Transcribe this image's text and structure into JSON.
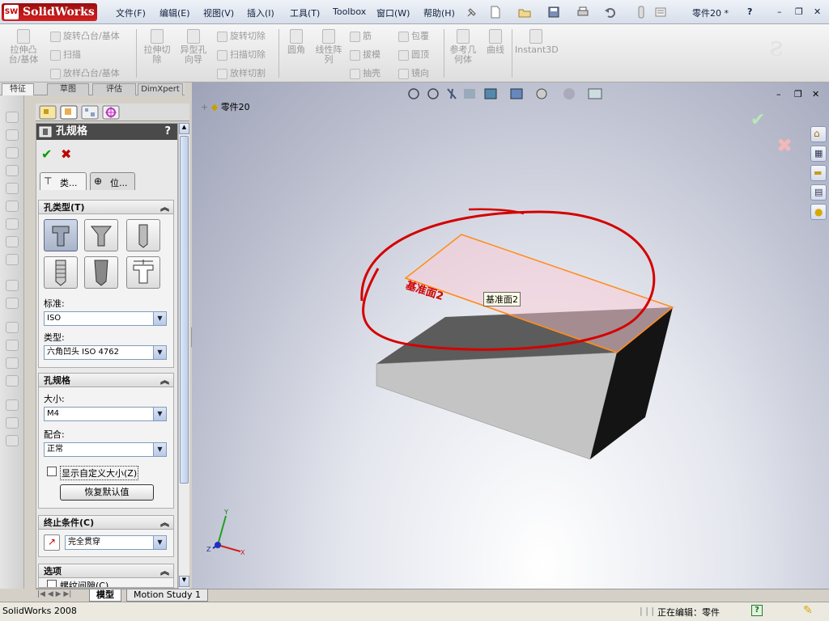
{
  "app": {
    "name": "SolidWorks",
    "doc_title": "零件20 *",
    "version_status": "SolidWorks 2008",
    "edit_status": "正在编辑：零件"
  },
  "menu": [
    "文件(F)",
    "编辑(E)",
    "视图(V)",
    "插入(I)",
    "工具(T)",
    "Toolbox",
    "窗口(W)",
    "帮助(H)"
  ],
  "command_manager": {
    "extrude_boss": "拉伸凸\n台/基体",
    "revolve_boss": "旋转凸台/基体",
    "sweep": "扫描",
    "loft_boss": "放样凸台/基体",
    "extrude_cut": "拉伸切\n除",
    "hole_wizard": "异型孔\n向导",
    "revolve_cut": "旋转切除",
    "sweep_cut": "扫描切除",
    "loft_cut": "放样切割",
    "fillet": "圆角",
    "linear_pattern": "线性阵\n列",
    "rib": "筋",
    "draft": "拔模",
    "shell": "抽壳",
    "wrap": "包覆",
    "dome": "圆顶",
    "mirror": "镜向",
    "ref_geometry": "参考几\n何体",
    "curves": "曲线",
    "instant3d": "Instant3D"
  },
  "tabs": {
    "features": "特征",
    "sketch": "草图",
    "evaluate": "评估",
    "dimxpert": "DimXpert"
  },
  "property_manager": {
    "title": "孔规格",
    "help": "?",
    "subtab_type": "类...",
    "subtab_position": "位...",
    "hole_type_group": "孔类型(T)",
    "standard_label": "标准:",
    "standard_value": "ISO",
    "type_label": "类型:",
    "type_value": "六角凹头 ISO 4762",
    "hole_spec_group": "孔规格",
    "size_label": "大小:",
    "size_value": "M4",
    "fit_label": "配合:",
    "fit_value": "正常",
    "custom_size_checkbox": "显示自定义大小(Z)",
    "restore_defaults": "恢复默认值",
    "end_condition_group": "终止条件(C)",
    "end_condition_value": "完全贯穿",
    "options_group": "选项",
    "options_first": "螺纹间隙(C)"
  },
  "viewport": {
    "tree_item": "零件20",
    "plane_label_3d": "基准面2",
    "plane_tag": "基准面2"
  },
  "bottom_tabs": {
    "model": "模型",
    "motion": "Motion Study 1"
  },
  "colors": {
    "accent": "#d40000",
    "plane_edge": "#ff8c1a",
    "menu_text": "#102040"
  }
}
